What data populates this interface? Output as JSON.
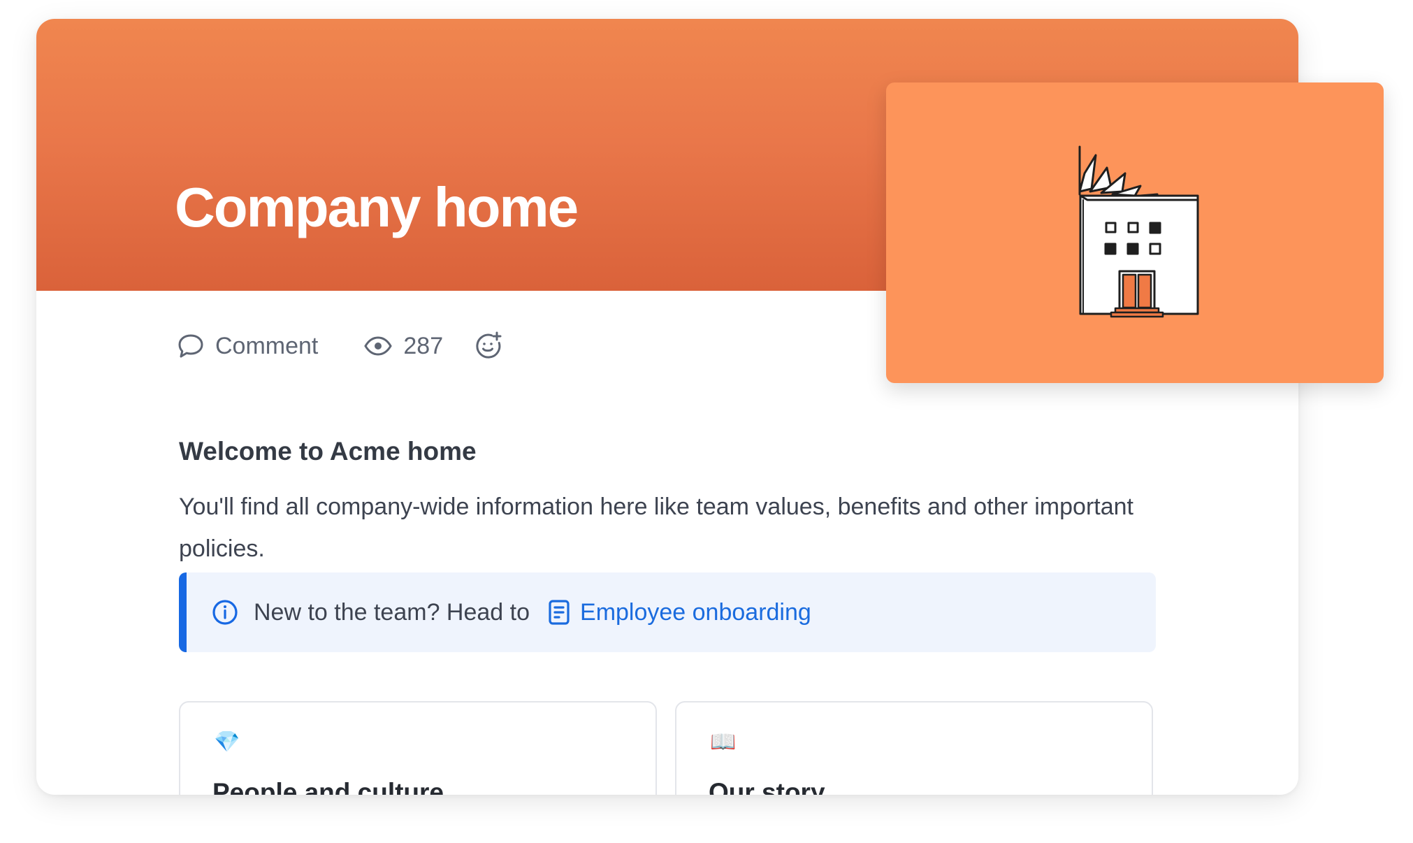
{
  "page": {
    "title": "Company home"
  },
  "meta": {
    "comment_label": "Comment",
    "view_count": "287",
    "icons": {
      "comment": "comment-bubble-icon",
      "views": "eye-icon",
      "reaction": "add-reaction-icon"
    }
  },
  "content": {
    "welcome_heading": "Welcome to Acme home",
    "welcome_body": "You'll find all company-wide information here like team values, benefits and other important policies."
  },
  "info_panel": {
    "text": "New to the team? Head to",
    "link_label": "Employee onboarding",
    "icons": {
      "info": "info-circle-icon",
      "link": "document-icon"
    }
  },
  "tiles": [
    {
      "emoji": "💎",
      "title": "People and culture",
      "icon": "gem-icon"
    },
    {
      "emoji": "📖",
      "title": "Our story",
      "icon": "open-book-icon"
    }
  ],
  "cover": {
    "illustration": "building-icon"
  },
  "colors": {
    "header_top": "#f0864f",
    "header_bottom": "#da623a",
    "cover_background": "#fd945a",
    "link_blue": "#1a6bde",
    "panel_accent": "#1768e3",
    "panel_background": "#eff4fd"
  }
}
